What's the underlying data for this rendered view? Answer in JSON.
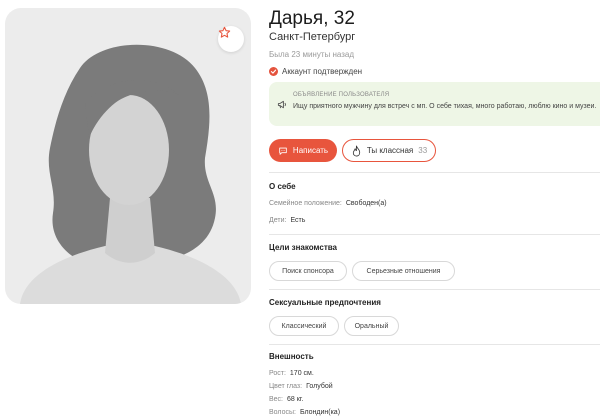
{
  "profile": {
    "name": "Дарья, 32",
    "city": "Санкт-Петербург",
    "last_seen": "Была 23 минуты назад",
    "verified": "Аккаунт подтвержден"
  },
  "announcement": {
    "title": "ОБЪЯВЛЕНИЕ ПОЛЬЗОВАТЕЛЯ",
    "text": "Ищу приятного мужчину для встреч с мп. О себе тихая, много работаю, люблю кино и музеи."
  },
  "actions": {
    "write_label": "Написать",
    "like_label": "Ты классная",
    "like_count": "33"
  },
  "about": {
    "title": "О себе",
    "rows": [
      {
        "key": "Семейное положение:",
        "value": "Свободен(а)"
      },
      {
        "key": "Дети:",
        "value": "Есть"
      }
    ]
  },
  "goals": {
    "title": "Цели знакомства",
    "chips": [
      "Поиск спонсора",
      "Серьезные отношения"
    ]
  },
  "preferences": {
    "title": "Сексуальные предпочтения",
    "chips": [
      "Классический",
      "Оральный"
    ]
  },
  "appearance": {
    "title": "Внешность",
    "rows": [
      {
        "key": "Рост:",
        "value": "170 см."
      },
      {
        "key": "Цвет глаз:",
        "value": "Голубой"
      },
      {
        "key": "Вес:",
        "value": "68 кг."
      },
      {
        "key": "Волосы:",
        "value": "Блондин(ка)"
      }
    ]
  },
  "icons": {
    "favorite": "star-icon",
    "verified": "check-icon",
    "announcement": "megaphone-icon",
    "write": "chat-icon",
    "like": "flame-icon"
  },
  "colors": {
    "accent": "#e8553d",
    "announce_bg": "#eef6e6"
  }
}
